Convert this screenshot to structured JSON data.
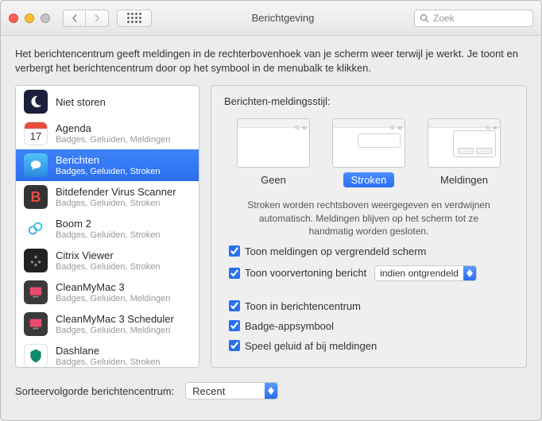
{
  "window": {
    "title": "Berichtgeving"
  },
  "search": {
    "placeholder": "Zoek"
  },
  "intro": "Het berichtencentrum geeft meldingen in de rechterbovenhoek van je scherm weer terwijl je werkt. Je toont en verbergt het berichtencentrum door op het symbool in de menubalk te klikken.",
  "apps": [
    {
      "name": "Niet storen",
      "sub": "",
      "icon": "moon"
    },
    {
      "name": "Agenda",
      "sub": "Badges, Geluiden, Meldingen",
      "icon": "calendar",
      "date": "17"
    },
    {
      "name": "Berichten",
      "sub": "Badges, Geluiden, Stroken",
      "icon": "messages",
      "selected": true
    },
    {
      "name": "Bitdefender Virus Scanner",
      "sub": "Badges, Geluiden, Stroken",
      "icon": "b"
    },
    {
      "name": "Boom 2",
      "sub": "Badges, Geluiden, Stroken",
      "icon": "boom"
    },
    {
      "name": "Citrix Viewer",
      "sub": "Badges, Geluiden, Stroken",
      "icon": "citrix"
    },
    {
      "name": "CleanMyMac 3",
      "sub": "Badges, Geluiden, Meldingen",
      "icon": "cmm"
    },
    {
      "name": "CleanMyMac 3 Scheduler",
      "sub": "Badges, Geluiden, Meldingen",
      "icon": "cmm"
    },
    {
      "name": "Dashlane",
      "sub": "Badges, Geluiden, Stroken",
      "icon": "dash"
    }
  ],
  "style": {
    "heading": "Berichten-meldingsstijl:",
    "options": {
      "none": "Geen",
      "banners": "Stroken",
      "alerts": "Meldingen"
    },
    "desc": "Stroken worden rechtsboven weergegeven en verdwijnen automatisch. Meldingen blijven op het scherm tot ze handmatig worden gesloten."
  },
  "checks": {
    "lockscreen": "Toon meldingen op vergrendeld scherm",
    "preview": "Toon voorvertoning bericht",
    "preview_select": "indien ontgrendeld",
    "notif_center": "Toon in berichtencentrum",
    "badge": "Badge-appsymbool",
    "sound": "Speel geluid af bij meldingen"
  },
  "sort": {
    "label": "Sorteervolgorde berichtencentrum:",
    "value": "Recent"
  }
}
